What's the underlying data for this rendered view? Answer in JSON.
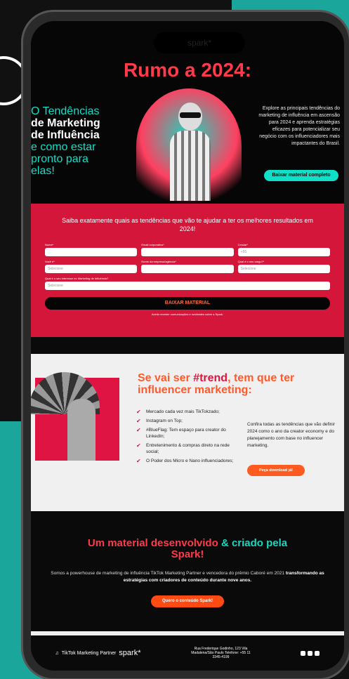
{
  "hero": {
    "title_part1": "Rumo a 2024:",
    "left_line1": "O Tendências",
    "left_line2": "de Marketing",
    "left_line3": "de Influência",
    "left_line4": "e como estar",
    "left_line5": "pronto para",
    "left_line6": "elas!",
    "right_text": "Explore as principais tendências do marketing de influência em ascensão para 2024 e aprenda estratégias eficazes para potencializar seu negócio com os influenciadores mais impactantes do Brasil.",
    "cta": "Baixar material completo"
  },
  "form": {
    "heading": "Saiba exatamente quais as tendências que vão te ajudar a ter os melhores resultados em 2024!",
    "fields": [
      {
        "label": "Nome*",
        "placeholder": ""
      },
      {
        "label": "Email corporativo*",
        "placeholder": ""
      },
      {
        "label": "Celular*",
        "placeholder": "+55"
      },
      {
        "label": "Você é*",
        "placeholder": "Selecione"
      },
      {
        "label": "Nome da empresa/agência*",
        "placeholder": ""
      },
      {
        "label": "Qual é o seu cargo?*",
        "placeholder": "Selecione"
      },
      {
        "label": "Qual é o seu interesse no Marketing de Influência?",
        "placeholder": "Selecione"
      }
    ],
    "submit": "BAIXAR MATERIAL",
    "consent": "Aceito receber comunicações e novidades sobre a Spark."
  },
  "trend": {
    "title_a": "Se vai ser ",
    "title_b": "#trend",
    "title_c": ", tem que ter influencer marketing:",
    "items": [
      "Mercado cada vez mais TikTokzado;",
      "Instagram on Top;",
      "#BlueFlag: Tem espaço para creator do LinkedIn;",
      "Entretenimento & compras direto na rede social;",
      "O Poder dos Micro e Nano influenciadores;"
    ],
    "right_text": "Confira todas as tendências que vão definir 2024 como o ano da creator economy e do planejamento com base no influencer marketing.",
    "cta": "Peça download já!"
  },
  "material": {
    "title_a": "Um material desenvolvido ",
    "title_b": "& criado pela",
    "title_c": "Spark!",
    "text_a": "Somos a powerhouse de marketing de influência TikTok Marketing Partner e vencedora do prêmio Caboré em 2021 ",
    "text_b": "transformando as estratégias com criadores de conteúdo durante nove anos.",
    "cta": "Quero o conteúdo Spark!"
  },
  "footer": {
    "tiktok": "TikTok Marketing Partner",
    "spark": "spark*",
    "address": "Rua Frederique Godinho, 123 Vila Madalena/São Paulo Telefone: +55 11 3345-4199"
  },
  "notch_text": "spark*"
}
